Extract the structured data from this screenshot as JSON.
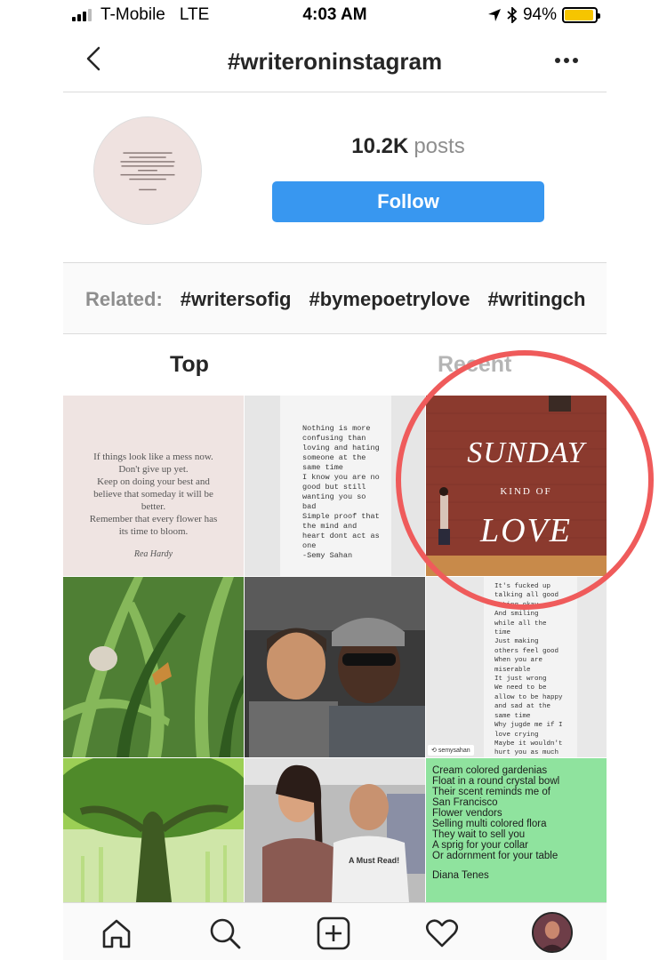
{
  "status_bar": {
    "carrier": "T-Mobile",
    "network": "LTE",
    "time": "4:03 AM",
    "battery": "94%",
    "battery_level": 0.94
  },
  "header": {
    "title": "#writeroninstagram"
  },
  "hashtag": {
    "post_count": "10.2K",
    "posts_label": "posts",
    "follow_label": "Follow"
  },
  "related": {
    "label": "Related:",
    "tags": [
      "#writersofig",
      "#bymepoetrylove",
      "#writingch"
    ]
  },
  "tabs": {
    "top": "Top",
    "recent": "Recent"
  },
  "grid": {
    "post1_text": "If things look like a mess now.\nDon't give up yet.\nKeep on doing your best and\nbelieve that someday it will be\nbetter.\nRemember that every flower has\nits time to bloom.",
    "post1_signature": "Rea Hardy",
    "post2_text": "Nothing is more\nconfusing than\nloving and hating\nsomeone at the\nsame time\nI know you are no\ngood but still\nwanting you so\nbad\nSimple proof that\nthe mind and\nheart dont act as\none\n-Semy Sahan",
    "post3_mural_line1": "SUNDAY",
    "post3_mural_line2": "KIND OF",
    "post3_mural_line3": "LOVE",
    "post6_text": "It's fucked up\ntalking all good\nActing okay\nAnd smiling\nwhile all the\ntime\nJust making\nothers feel good\nWhen you are\nmiserable\nIt just wrong\nWe need to be\nallow to be happy\nand sad at the\nsame time\nWhy jugde me if I\nlove crying\nMaybe it wouldn't\nhurt you as much\nas me\nBut it did\nSo fuck off\nIf youre\ndisgusted by it\n-Semy Sahan",
    "post6_repost": "semysahan",
    "post8_shirt_text": "A Must Read!",
    "post9_text": "Cream colored gardenias\nFloat in a round crystal bowl\nTheir scent reminds me of\nSan Francisco\nFlower vendors\nSelling multi colored flora\nThey wait to sell you\nA sprig for your collar\nOr adornment for your table",
    "post9_author": "Diana Tenes"
  },
  "colors": {
    "follow_blue": "#3897f0",
    "highlight_red": "#ef5b5b",
    "battery_yellow": "#f6c500"
  }
}
